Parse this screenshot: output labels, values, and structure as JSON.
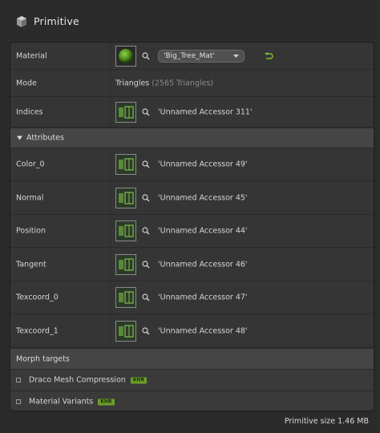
{
  "header": {
    "title": "Primitive",
    "icon": "cube-icon"
  },
  "material": {
    "label": "Material",
    "selected": "'Big_Tree_Mat'",
    "icon": "sphere-icon"
  },
  "mode": {
    "label": "Mode",
    "value": "Triangles",
    "detail": "(2565 Triangles)"
  },
  "indices": {
    "label": "Indices",
    "value": "'Unnamed Accessor 311'"
  },
  "attributes": {
    "section_label": "Attributes",
    "items": [
      {
        "label": "Color_0",
        "value": "'Unnamed Accessor 49'"
      },
      {
        "label": "Normal",
        "value": "'Unnamed Accessor 45'"
      },
      {
        "label": "Position",
        "value": "'Unnamed Accessor 44'"
      },
      {
        "label": "Tangent",
        "value": "'Unnamed Accessor 46'"
      },
      {
        "label": "Texcoord_0",
        "value": "'Unnamed Accessor 47'"
      },
      {
        "label": "Texcoord_1",
        "value": "'Unnamed Accessor 48'"
      }
    ]
  },
  "morph_targets": {
    "label": "Morph targets"
  },
  "extensions": [
    {
      "label": "Draco Mesh Compression",
      "badge": "KHR",
      "checked": false
    },
    {
      "label": "Material Variants",
      "badge": "KHR",
      "checked": false
    }
  ],
  "footer": {
    "primitive_size": "Primitive size 1.46 MB"
  },
  "colors": {
    "accent": "#6a9f2a",
    "undo": "#7fbf2f"
  }
}
